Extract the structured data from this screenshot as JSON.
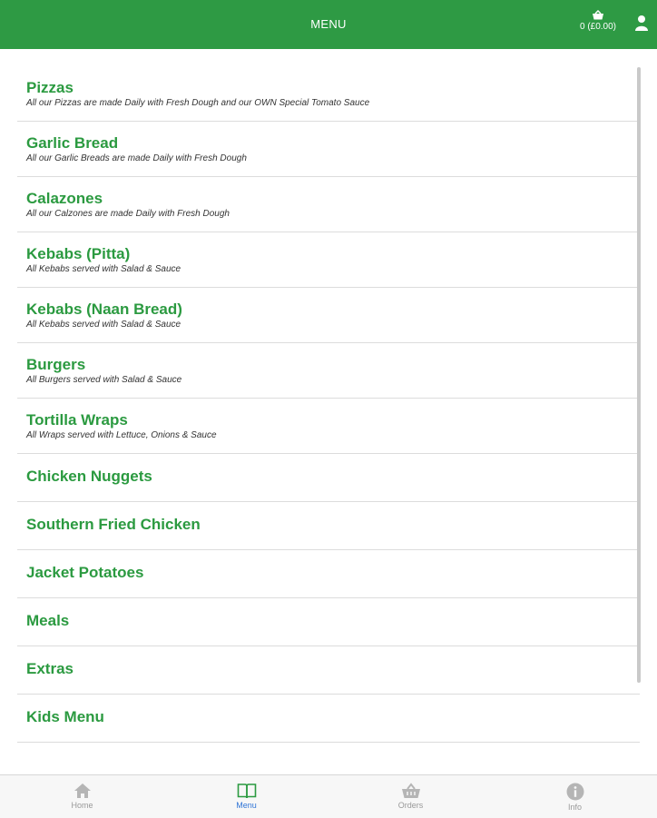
{
  "header": {
    "title": "MENU",
    "basket_count": "0 (£0.00)"
  },
  "menu": {
    "items": [
      {
        "name": "Pizzas",
        "desc": "All our Pizzas are made Daily with Fresh Dough and our OWN Special Tomato Sauce"
      },
      {
        "name": "Garlic Bread",
        "desc": "All our Garlic Breads are made Daily with Fresh Dough"
      },
      {
        "name": "Calazones",
        "desc": "All our Calzones are made Daily with Fresh Dough"
      },
      {
        "name": "Kebabs (Pitta)",
        "desc": "All Kebabs served with Salad & Sauce"
      },
      {
        "name": "Kebabs (Naan Bread)",
        "desc": "All Kebabs served with Salad & Sauce"
      },
      {
        "name": "Burgers",
        "desc": "All Burgers served with Salad & Sauce"
      },
      {
        "name": "Tortilla Wraps",
        "desc": "All Wraps served with Lettuce, Onions & Sauce"
      },
      {
        "name": "Chicken Nuggets"
      },
      {
        "name": "Southern Fried Chicken"
      },
      {
        "name": "Jacket Potatoes"
      },
      {
        "name": "Meals"
      },
      {
        "name": "Extras"
      },
      {
        "name": "Kids Menu"
      }
    ]
  },
  "nav": {
    "tabs": [
      {
        "label": "Home",
        "icon": "home-icon"
      },
      {
        "label": "Menu",
        "icon": "book-icon"
      },
      {
        "label": "Orders",
        "icon": "basket-icon"
      },
      {
        "label": "Info",
        "icon": "info-icon"
      }
    ],
    "active": "Menu"
  },
  "colors": {
    "brand": "#2e9a44",
    "item_text": "#2b9a40",
    "active_tab": "#2f74d6"
  }
}
